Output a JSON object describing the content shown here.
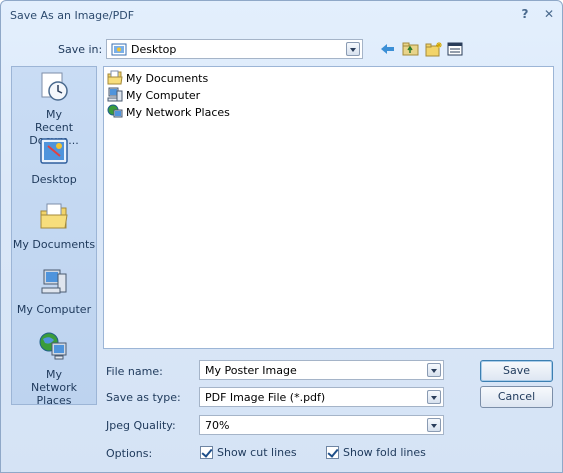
{
  "window": {
    "title": "Save As an Image/PDF"
  },
  "toolbar": {
    "save_in_label": "Save in:",
    "location": "Desktop"
  },
  "places": [
    {
      "label_line1": "My",
      "label_line2": "Recent Docum..."
    },
    {
      "label_line1": "Desktop",
      "label_line2": ""
    },
    {
      "label_line1": "My Documents",
      "label_line2": ""
    },
    {
      "label_line1": "My Computer",
      "label_line2": ""
    },
    {
      "label_line1": "My",
      "label_line2": "Network Places"
    }
  ],
  "files": [
    {
      "name": "My Documents",
      "icon": "folder-icon"
    },
    {
      "name": "My Computer",
      "icon": "computer-icon"
    },
    {
      "name": "My Network Places",
      "icon": "network-icon"
    }
  ],
  "form": {
    "file_name_label": "File name:",
    "file_name_value": "My Poster Image",
    "save_type_label": "Save as type:",
    "save_type_value": "PDF Image File (*.pdf)",
    "jpeg_quality_label": "Jpeg Quality:",
    "jpeg_quality_value": "70%",
    "options_label": "Options:",
    "show_cut_lines": "Show cut lines",
    "show_fold_lines": "Show fold lines"
  },
  "buttons": {
    "save": "Save",
    "cancel": "Cancel"
  },
  "colors": {
    "accent": "#3c7fb1",
    "background": "#dbe8f8"
  }
}
